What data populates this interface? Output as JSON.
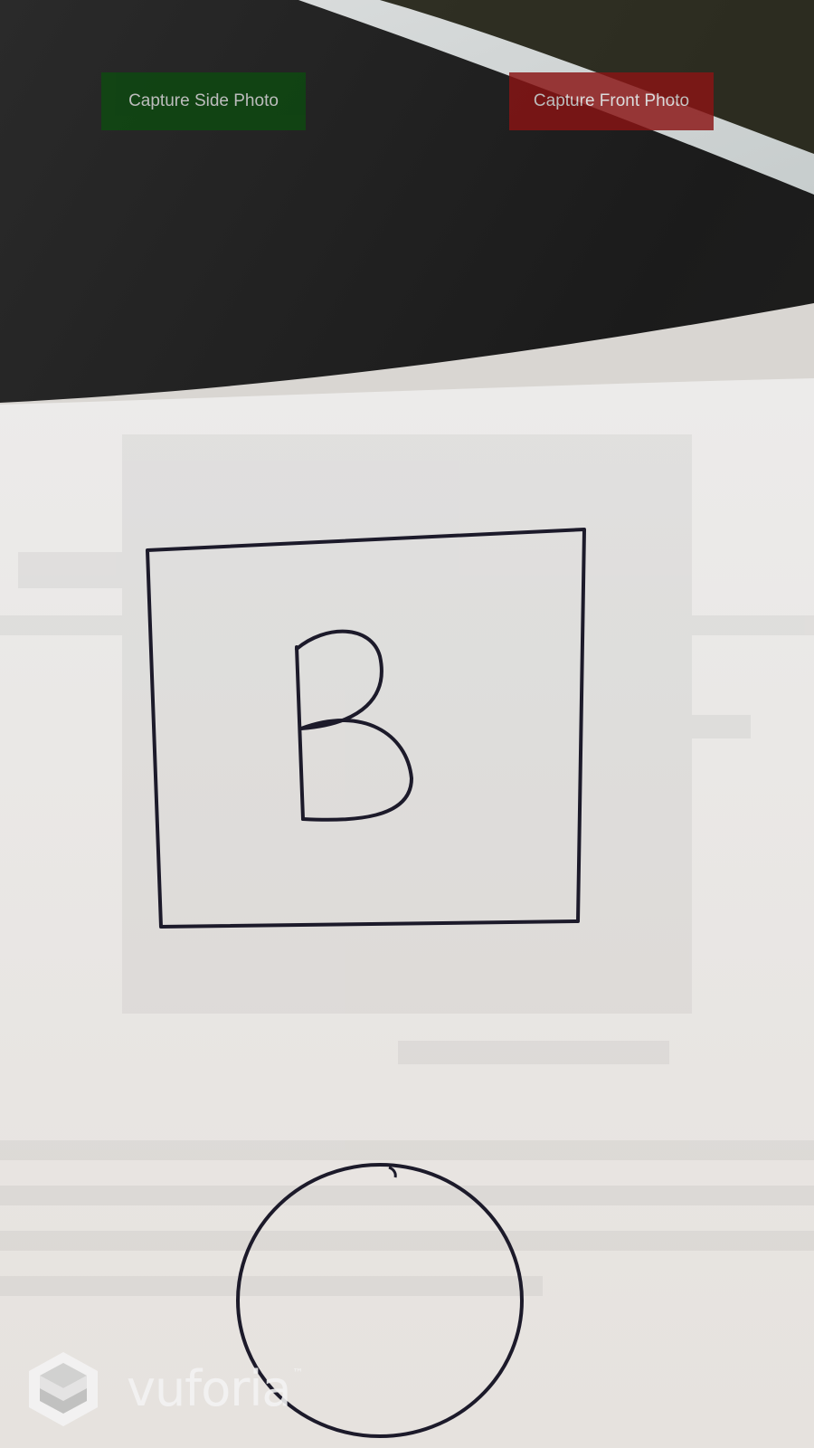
{
  "buttons": {
    "side": {
      "label": "Capture Side Photo",
      "color": "#0d4a10"
    },
    "front": {
      "label": "Capture Front Photo",
      "color": "#8a1414"
    }
  },
  "paper": {
    "drawn_letter": "B",
    "shapes": [
      "square-outline",
      "circle-outline"
    ]
  },
  "watermark": {
    "text": "vuforia",
    "trademark": "™",
    "icon": "vuforia-cube-icon"
  },
  "colors": {
    "desk": "#1f1f1f",
    "paper": "#e9e6e2",
    "ink": "#1c1a2a"
  }
}
